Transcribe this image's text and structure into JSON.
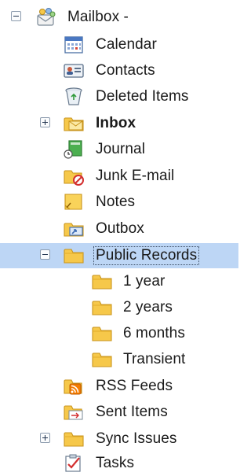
{
  "tree": {
    "root": {
      "label": "Mailbox -",
      "icon": "mailbox-icon",
      "expanded": true
    },
    "items": [
      {
        "label": "Calendar",
        "icon": "calendar-icon"
      },
      {
        "label": "Contacts",
        "icon": "contacts-card-icon"
      },
      {
        "label": "Deleted Items",
        "icon": "recycle-bin-icon"
      },
      {
        "label": "Inbox",
        "icon": "inbox-folder-icon",
        "bold": true,
        "expanded": false
      },
      {
        "label": "Journal",
        "icon": "journal-icon"
      },
      {
        "label": "Junk E-mail",
        "icon": "junk-mail-folder-icon"
      },
      {
        "label": "Notes",
        "icon": "notes-icon"
      },
      {
        "label": "Outbox",
        "icon": "outbox-folder-icon"
      },
      {
        "label": "Public Records",
        "icon": "folder-icon",
        "selected": true,
        "expanded": true,
        "children": [
          {
            "label": "1 year",
            "icon": "folder-icon"
          },
          {
            "label": "2 years",
            "icon": "folder-icon"
          },
          {
            "label": "6 months",
            "icon": "folder-icon"
          },
          {
            "label": "Transient",
            "icon": "folder-icon"
          }
        ]
      },
      {
        "label": "RSS Feeds",
        "icon": "rss-folder-icon"
      },
      {
        "label": "Sent Items",
        "icon": "sent-items-folder-icon"
      },
      {
        "label": "Sync Issues",
        "icon": "folder-icon",
        "expanded": false
      },
      {
        "label": "Tasks",
        "icon": "tasks-icon"
      }
    ]
  },
  "colors": {
    "selection": "#bdd6f5",
    "folder": "#f6c84a",
    "folder_dark": "#d9a21c",
    "text": "#1a1a1a"
  }
}
